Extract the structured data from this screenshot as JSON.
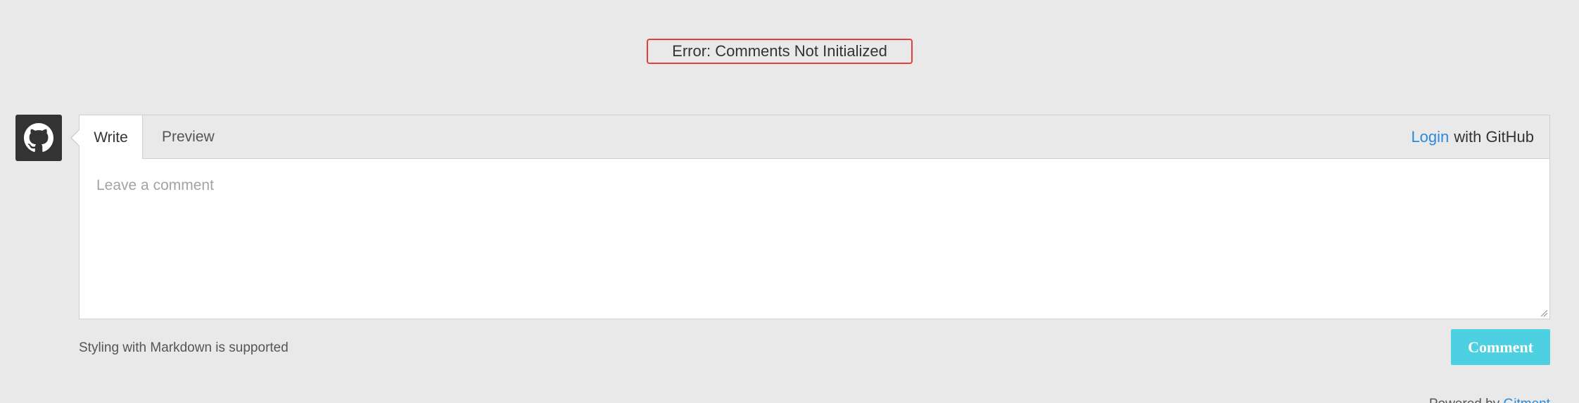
{
  "error": {
    "message": "Error: Comments Not Initialized",
    "border_color": "#e63e3e"
  },
  "avatar": {
    "icon": "github-icon"
  },
  "editor": {
    "tabs": [
      {
        "label": "Write",
        "active": true
      },
      {
        "label": "Preview",
        "active": false
      }
    ],
    "login": {
      "link_label": "Login",
      "suffix": "with GitHub"
    },
    "textarea": {
      "placeholder": "Leave a comment",
      "value": ""
    }
  },
  "footer": {
    "markdown_hint": "Styling with Markdown is supported",
    "comment_button": "Comment",
    "powered_by_prefix": "Powered by",
    "powered_by_link": "Gitment"
  },
  "colors": {
    "background": "#e9e9e9",
    "accent": "#4dd0e1",
    "link": "#2a8ad9"
  }
}
